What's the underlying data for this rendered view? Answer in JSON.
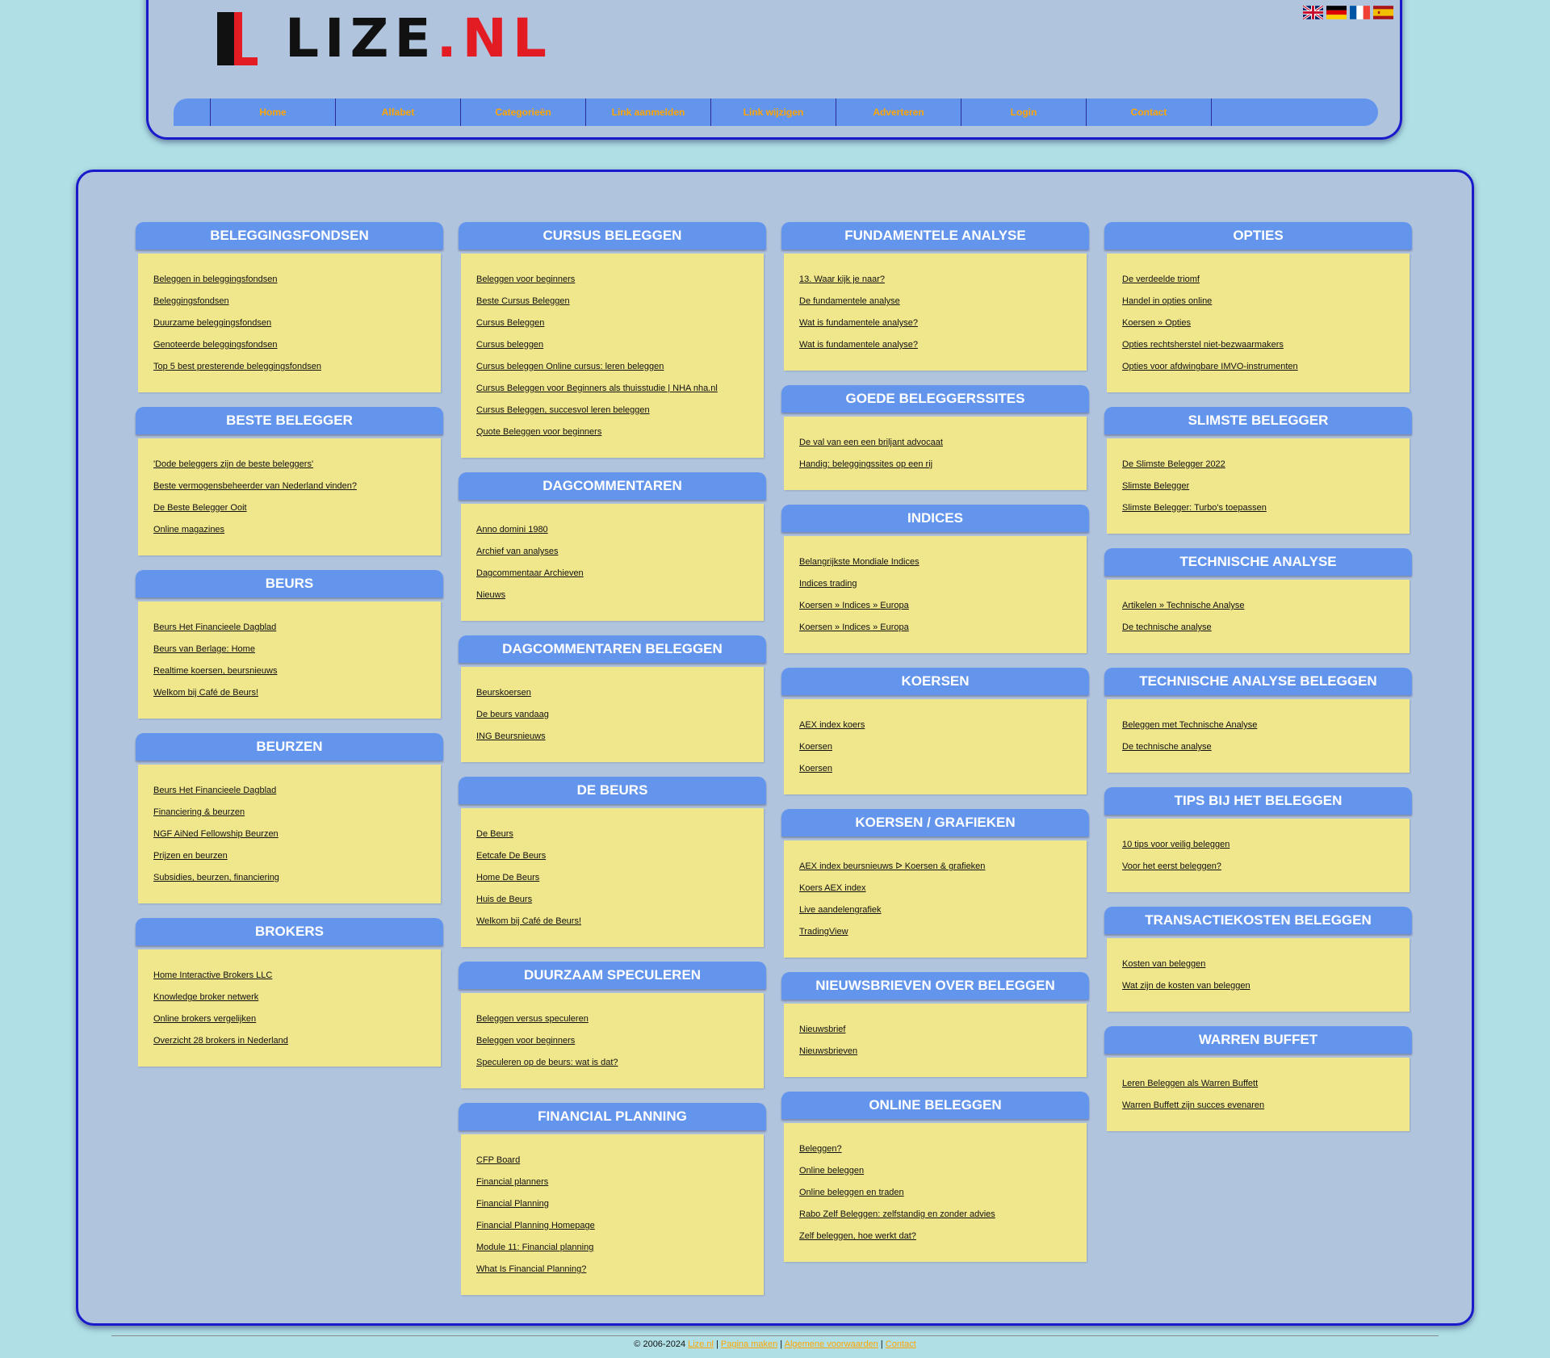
{
  "header": {
    "logo": {
      "text_main": "LIZE",
      "text_tld": ".NL"
    },
    "flags": [
      {
        "icon": "flag-uk-icon",
        "label": "English"
      },
      {
        "icon": "flag-de-icon",
        "label": "Deutsch"
      },
      {
        "icon": "flag-fr-icon",
        "label": "Français"
      },
      {
        "icon": "flag-es-icon",
        "label": "Español"
      }
    ],
    "nav": [
      "Home",
      "Alfabet",
      "Categorieën",
      "Link aanmelden",
      "Link wijzigen",
      "Adverteren",
      "Login",
      "Contact"
    ]
  },
  "colors": {
    "page_bg": "#b0e0e6",
    "panel_bg": "#b0c4de",
    "panel_border": "#1a1acc",
    "header_bar": "#6495ed",
    "box_body": "#f0e68c",
    "link_accent": "#ffa500",
    "logo_red": "#e31b23"
  },
  "columns": [
    [
      {
        "title": "BELEGGINGSFONDSEN",
        "links": [
          "Beleggen in beleggingsfondsen",
          "Beleggingsfondsen",
          "Duurzame beleggingsfondsen",
          "Genoteerde beleggingsfondsen",
          "Top 5 best presterende beleggingsfondsen"
        ]
      },
      {
        "title": "BESTE BELEGGER",
        "links": [
          "'Dode beleggers zijn de beste beleggers'",
          "Beste vermogensbeheerder van Nederland vinden?",
          "De Beste Belegger Ooit",
          "Online magazines"
        ]
      },
      {
        "title": "BEURS",
        "links": [
          "Beurs Het Financieele Dagblad",
          "Beurs van Berlage: Home",
          "Realtime koersen, beursnieuws",
          "Welkom bij Café de Beurs!"
        ]
      },
      {
        "title": "BEURZEN",
        "links": [
          "Beurs Het Financieele Dagblad",
          "Financiering & beurzen",
          "NGF AiNed Fellowship Beurzen",
          "Prijzen en beurzen",
          "Subsidies, beurzen, financiering"
        ]
      },
      {
        "title": "BROKERS",
        "links": [
          "Home Interactive Brokers LLC",
          "Knowledge broker netwerk",
          "Online brokers vergelijken",
          "Overzicht 28 brokers in Nederland"
        ]
      }
    ],
    [
      {
        "title": "CURSUS BELEGGEN",
        "links": [
          "Beleggen voor beginners",
          "Beste Cursus Beleggen",
          "Cursus Beleggen",
          "Cursus beleggen",
          "Cursus beleggen Online cursus: leren beleggen",
          "Cursus Beleggen voor Beginners als thuisstudie | NHA nha.nl",
          "Cursus Beleggen, succesvol leren beleggen",
          "Quote Beleggen voor beginners"
        ]
      },
      {
        "title": "DAGCOMMENTAREN",
        "links": [
          "Anno domini 1980",
          "Archief van analyses",
          "Dagcommentaar Archieven",
          "Nieuws"
        ]
      },
      {
        "title": "DAGCOMMENTAREN BELEGGEN",
        "links": [
          "Beurskoersen",
          "De beurs vandaag",
          "ING Beursnieuws"
        ]
      },
      {
        "title": "DE BEURS",
        "links": [
          "De Beurs",
          "Eetcafe De Beurs",
          "Home De Beurs",
          "Huis de Beurs",
          "Welkom bij Café de Beurs!"
        ]
      },
      {
        "title": "DUURZAAM SPECULEREN",
        "links": [
          "Beleggen versus speculeren",
          "Beleggen voor beginners",
          "Speculeren op de beurs: wat is dat?"
        ]
      },
      {
        "title": "FINANCIAL PLANNING",
        "links": [
          "CFP Board",
          "Financial planners",
          "Financial Planning",
          "Financial Planning Homepage",
          "Module 11: Financial planning",
          "What Is Financial Planning?"
        ]
      }
    ],
    [
      {
        "title": "FUNDAMENTELE ANALYSE",
        "links": [
          "13. Waar kijk je naar?",
          "De fundamentele analyse",
          "Wat is fundamentele analyse?",
          "Wat is fundamentele analyse?"
        ]
      },
      {
        "title": "GOEDE BELEGGERSSITES",
        "links": [
          "De val van een een briljant advocaat",
          "Handig: beleggingssites op een rij"
        ]
      },
      {
        "title": "INDICES",
        "links": [
          "Belangrijkste Mondiale Indices",
          "Indices trading",
          "Koersen » Indices » Europa",
          "Koersen » Indices » Europa"
        ]
      },
      {
        "title": "KOERSEN",
        "links": [
          "AEX index koers",
          "Koersen",
          "Koersen"
        ]
      },
      {
        "title": "KOERSEN / GRAFIEKEN",
        "links": [
          "AEX index beursnieuws ᐅ Koersen & grafieken",
          "Koers AEX index",
          "Live aandelengrafiek",
          "TradingView"
        ]
      },
      {
        "title": "NIEUWSBRIEVEN OVER BELEGGEN",
        "links": [
          "Nieuwsbrief",
          "Nieuwsbrieven"
        ]
      },
      {
        "title": "ONLINE BELEGGEN",
        "links": [
          "Beleggen?",
          "Online beleggen",
          "Online beleggen en traden",
          "Rabo Zelf Beleggen: zelfstandig en zonder advies",
          "Zelf beleggen, hoe werkt dat?"
        ]
      }
    ],
    [
      {
        "title": "OPTIES",
        "links": [
          "De verdeelde triomf",
          "Handel in opties online",
          "Koersen » Opties",
          "Opties rechtsherstel niet-bezwaarmakers",
          "Opties voor afdwingbare IMVO-instrumenten"
        ]
      },
      {
        "title": "SLIMSTE BELEGGER",
        "links": [
          "De Slimste Belegger 2022",
          "Slimste Belegger",
          "Slimste Belegger: Turbo's toepassen"
        ]
      },
      {
        "title": "TECHNISCHE ANALYSE",
        "links": [
          "Artikelen » Technische Analyse",
          "De technische analyse"
        ]
      },
      {
        "title": "TECHNISCHE ANALYSE BELEGGEN",
        "links": [
          "Beleggen met Technische Analyse",
          "De technische analyse"
        ]
      },
      {
        "title": "TIPS BIJ HET BELEGGEN",
        "links": [
          "10 tips voor veilig beleggen",
          "Voor het eerst beleggen?"
        ]
      },
      {
        "title": "TRANSACTIEKOSTEN BELEGGEN",
        "links": [
          "Kosten van beleggen",
          "Wat zijn de kosten van beleggen"
        ]
      },
      {
        "title": "WARREN BUFFET",
        "links": [
          "Leren Beleggen als Warren Buffett",
          "Warren Buffett zijn succes evenaren"
        ]
      }
    ]
  ],
  "footer": {
    "copyright": "© 2006-2024",
    "links": [
      "Lize.nl",
      "Pagina maken",
      "Algemene voorwaarden",
      "Contact"
    ],
    "separator": "|"
  }
}
